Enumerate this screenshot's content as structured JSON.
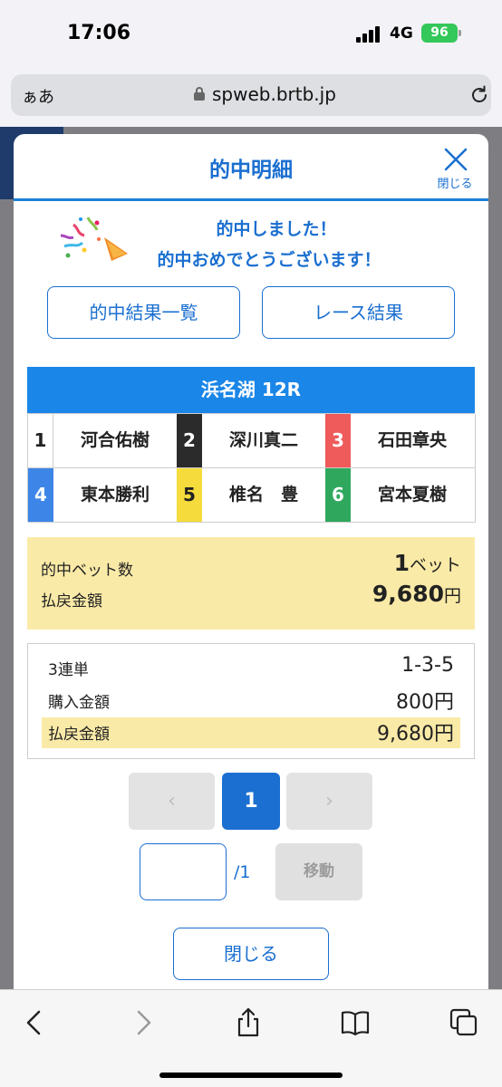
{
  "status_bar": {
    "time": "17:06",
    "network": "4G",
    "battery": "96"
  },
  "browser": {
    "text_size": "ぁあ",
    "url": "spweb.brtb.jp"
  },
  "modal": {
    "title": "的中明細",
    "close_label": "閉じる",
    "message_line1": "的中しました！",
    "message_line2": "的中おめでとうございます！",
    "buttons": {
      "results_list": "的中結果一覧",
      "race_result": "レース結果"
    },
    "race": "浜名湖 12R",
    "racers": [
      {
        "num": "1",
        "name": "河合佑樹",
        "color": "#ffffff",
        "text_color": "#222222"
      },
      {
        "num": "2",
        "name": "深川真二",
        "color": "#2b2b2b",
        "text_color": "#ffffff"
      },
      {
        "num": "3",
        "name": "石田章央",
        "color": "#ef5a5a",
        "text_color": "#ffffff"
      },
      {
        "num": "4",
        "name": "東本勝利",
        "color": "#3d86e8",
        "text_color": "#ffffff"
      },
      {
        "num": "5",
        "name": "椎名　豊",
        "color": "#f5dc3c",
        "text_color": "#222222"
      },
      {
        "num": "6",
        "name": "宮本夏樹",
        "color": "#2fa85e",
        "text_color": "#ffffff"
      }
    ],
    "summary": {
      "bet_count_label": "的中ベット数",
      "bet_count": "1",
      "bet_unit": "ベット",
      "payout_label": "払戻金額",
      "payout": "9,680",
      "yen": "円"
    },
    "detail": {
      "bet_type": "3連単",
      "combination": "1-3-5",
      "purchase_label": "購入金額",
      "purchase": "800円",
      "payout_label": "払戻金額",
      "payout": "9,680円"
    },
    "pagination": {
      "prev": "‹",
      "current": "1",
      "next": "›",
      "total": "/1",
      "move": "移動"
    },
    "close_button": "閉じる"
  },
  "colors": {
    "accent": "#1a6fd0",
    "race_bar": "#1a86e8",
    "highlight": "#faeaa7"
  }
}
